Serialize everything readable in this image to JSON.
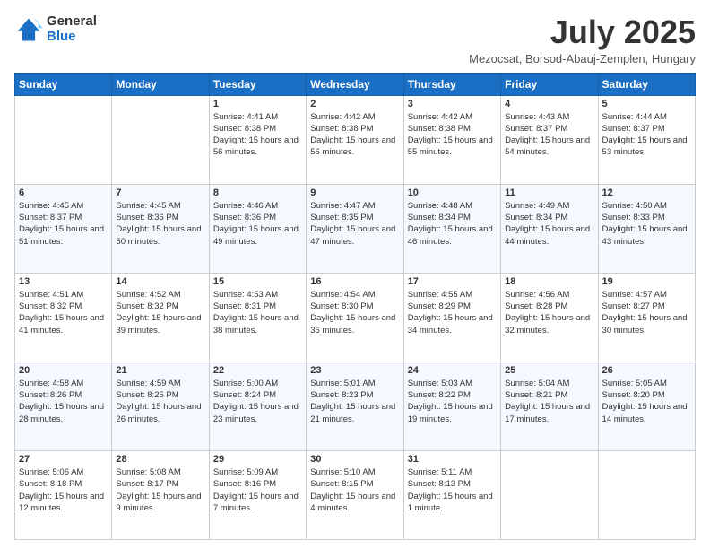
{
  "logo": {
    "general": "General",
    "blue": "Blue"
  },
  "title": "July 2025",
  "location": "Mezocsat, Borsod-Abauj-Zemplen, Hungary",
  "days_of_week": [
    "Sunday",
    "Monday",
    "Tuesday",
    "Wednesday",
    "Thursday",
    "Friday",
    "Saturday"
  ],
  "weeks": [
    [
      {
        "day": "",
        "sunrise": "",
        "sunset": "",
        "daylight": ""
      },
      {
        "day": "",
        "sunrise": "",
        "sunset": "",
        "daylight": ""
      },
      {
        "day": "1",
        "sunrise": "Sunrise: 4:41 AM",
        "sunset": "Sunset: 8:38 PM",
        "daylight": "Daylight: 15 hours and 56 minutes."
      },
      {
        "day": "2",
        "sunrise": "Sunrise: 4:42 AM",
        "sunset": "Sunset: 8:38 PM",
        "daylight": "Daylight: 15 hours and 56 minutes."
      },
      {
        "day": "3",
        "sunrise": "Sunrise: 4:42 AM",
        "sunset": "Sunset: 8:38 PM",
        "daylight": "Daylight: 15 hours and 55 minutes."
      },
      {
        "day": "4",
        "sunrise": "Sunrise: 4:43 AM",
        "sunset": "Sunset: 8:37 PM",
        "daylight": "Daylight: 15 hours and 54 minutes."
      },
      {
        "day": "5",
        "sunrise": "Sunrise: 4:44 AM",
        "sunset": "Sunset: 8:37 PM",
        "daylight": "Daylight: 15 hours and 53 minutes."
      }
    ],
    [
      {
        "day": "6",
        "sunrise": "Sunrise: 4:45 AM",
        "sunset": "Sunset: 8:37 PM",
        "daylight": "Daylight: 15 hours and 51 minutes."
      },
      {
        "day": "7",
        "sunrise": "Sunrise: 4:45 AM",
        "sunset": "Sunset: 8:36 PM",
        "daylight": "Daylight: 15 hours and 50 minutes."
      },
      {
        "day": "8",
        "sunrise": "Sunrise: 4:46 AM",
        "sunset": "Sunset: 8:36 PM",
        "daylight": "Daylight: 15 hours and 49 minutes."
      },
      {
        "day": "9",
        "sunrise": "Sunrise: 4:47 AM",
        "sunset": "Sunset: 8:35 PM",
        "daylight": "Daylight: 15 hours and 47 minutes."
      },
      {
        "day": "10",
        "sunrise": "Sunrise: 4:48 AM",
        "sunset": "Sunset: 8:34 PM",
        "daylight": "Daylight: 15 hours and 46 minutes."
      },
      {
        "day": "11",
        "sunrise": "Sunrise: 4:49 AM",
        "sunset": "Sunset: 8:34 PM",
        "daylight": "Daylight: 15 hours and 44 minutes."
      },
      {
        "day": "12",
        "sunrise": "Sunrise: 4:50 AM",
        "sunset": "Sunset: 8:33 PM",
        "daylight": "Daylight: 15 hours and 43 minutes."
      }
    ],
    [
      {
        "day": "13",
        "sunrise": "Sunrise: 4:51 AM",
        "sunset": "Sunset: 8:32 PM",
        "daylight": "Daylight: 15 hours and 41 minutes."
      },
      {
        "day": "14",
        "sunrise": "Sunrise: 4:52 AM",
        "sunset": "Sunset: 8:32 PM",
        "daylight": "Daylight: 15 hours and 39 minutes."
      },
      {
        "day": "15",
        "sunrise": "Sunrise: 4:53 AM",
        "sunset": "Sunset: 8:31 PM",
        "daylight": "Daylight: 15 hours and 38 minutes."
      },
      {
        "day": "16",
        "sunrise": "Sunrise: 4:54 AM",
        "sunset": "Sunset: 8:30 PM",
        "daylight": "Daylight: 15 hours and 36 minutes."
      },
      {
        "day": "17",
        "sunrise": "Sunrise: 4:55 AM",
        "sunset": "Sunset: 8:29 PM",
        "daylight": "Daylight: 15 hours and 34 minutes."
      },
      {
        "day": "18",
        "sunrise": "Sunrise: 4:56 AM",
        "sunset": "Sunset: 8:28 PM",
        "daylight": "Daylight: 15 hours and 32 minutes."
      },
      {
        "day": "19",
        "sunrise": "Sunrise: 4:57 AM",
        "sunset": "Sunset: 8:27 PM",
        "daylight": "Daylight: 15 hours and 30 minutes."
      }
    ],
    [
      {
        "day": "20",
        "sunrise": "Sunrise: 4:58 AM",
        "sunset": "Sunset: 8:26 PM",
        "daylight": "Daylight: 15 hours and 28 minutes."
      },
      {
        "day": "21",
        "sunrise": "Sunrise: 4:59 AM",
        "sunset": "Sunset: 8:25 PM",
        "daylight": "Daylight: 15 hours and 26 minutes."
      },
      {
        "day": "22",
        "sunrise": "Sunrise: 5:00 AM",
        "sunset": "Sunset: 8:24 PM",
        "daylight": "Daylight: 15 hours and 23 minutes."
      },
      {
        "day": "23",
        "sunrise": "Sunrise: 5:01 AM",
        "sunset": "Sunset: 8:23 PM",
        "daylight": "Daylight: 15 hours and 21 minutes."
      },
      {
        "day": "24",
        "sunrise": "Sunrise: 5:03 AM",
        "sunset": "Sunset: 8:22 PM",
        "daylight": "Daylight: 15 hours and 19 minutes."
      },
      {
        "day": "25",
        "sunrise": "Sunrise: 5:04 AM",
        "sunset": "Sunset: 8:21 PM",
        "daylight": "Daylight: 15 hours and 17 minutes."
      },
      {
        "day": "26",
        "sunrise": "Sunrise: 5:05 AM",
        "sunset": "Sunset: 8:20 PM",
        "daylight": "Daylight: 15 hours and 14 minutes."
      }
    ],
    [
      {
        "day": "27",
        "sunrise": "Sunrise: 5:06 AM",
        "sunset": "Sunset: 8:18 PM",
        "daylight": "Daylight: 15 hours and 12 minutes."
      },
      {
        "day": "28",
        "sunrise": "Sunrise: 5:08 AM",
        "sunset": "Sunset: 8:17 PM",
        "daylight": "Daylight: 15 hours and 9 minutes."
      },
      {
        "day": "29",
        "sunrise": "Sunrise: 5:09 AM",
        "sunset": "Sunset: 8:16 PM",
        "daylight": "Daylight: 15 hours and 7 minutes."
      },
      {
        "day": "30",
        "sunrise": "Sunrise: 5:10 AM",
        "sunset": "Sunset: 8:15 PM",
        "daylight": "Daylight: 15 hours and 4 minutes."
      },
      {
        "day": "31",
        "sunrise": "Sunrise: 5:11 AM",
        "sunset": "Sunset: 8:13 PM",
        "daylight": "Daylight: 15 hours and 1 minute."
      },
      {
        "day": "",
        "sunrise": "",
        "sunset": "",
        "daylight": ""
      },
      {
        "day": "",
        "sunrise": "",
        "sunset": "",
        "daylight": ""
      }
    ]
  ]
}
